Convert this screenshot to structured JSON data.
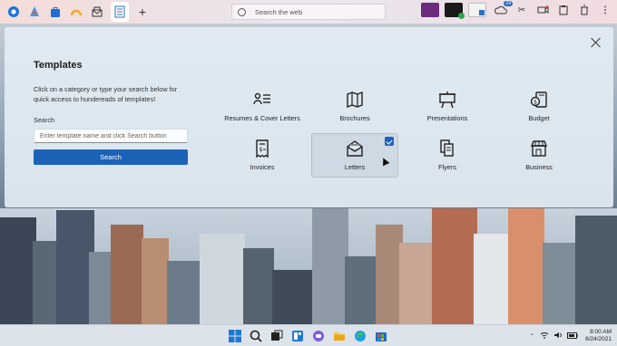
{
  "topbar": {
    "search_placeholder": "Search the web",
    "badge": "24"
  },
  "dialog": {
    "title": "Templates",
    "description": "Click on a category or type your search below for quick access to hundereads of templates!",
    "search_label": "Search",
    "search_placeholder": "Enter template name and click Search button",
    "search_button": "Search",
    "categories": [
      {
        "label": "Resumes & Cover Letters",
        "icon": "resume-icon"
      },
      {
        "label": "Brochures",
        "icon": "brochure-icon"
      },
      {
        "label": "Presentations",
        "icon": "presentation-icon"
      },
      {
        "label": "Budget",
        "icon": "budget-icon"
      },
      {
        "label": "Invoices",
        "icon": "invoice-icon"
      },
      {
        "label": "Letters",
        "icon": "letter-icon",
        "selected": true
      },
      {
        "label": "Flyers",
        "icon": "flyers-icon"
      },
      {
        "label": "Business",
        "icon": "business-icon"
      }
    ]
  },
  "taskbar": {
    "time": "8:00 AM",
    "date": "6/24/2021"
  },
  "colors": {
    "accent": "#1c63b8",
    "dialog_bg": "#e2ecf3"
  }
}
